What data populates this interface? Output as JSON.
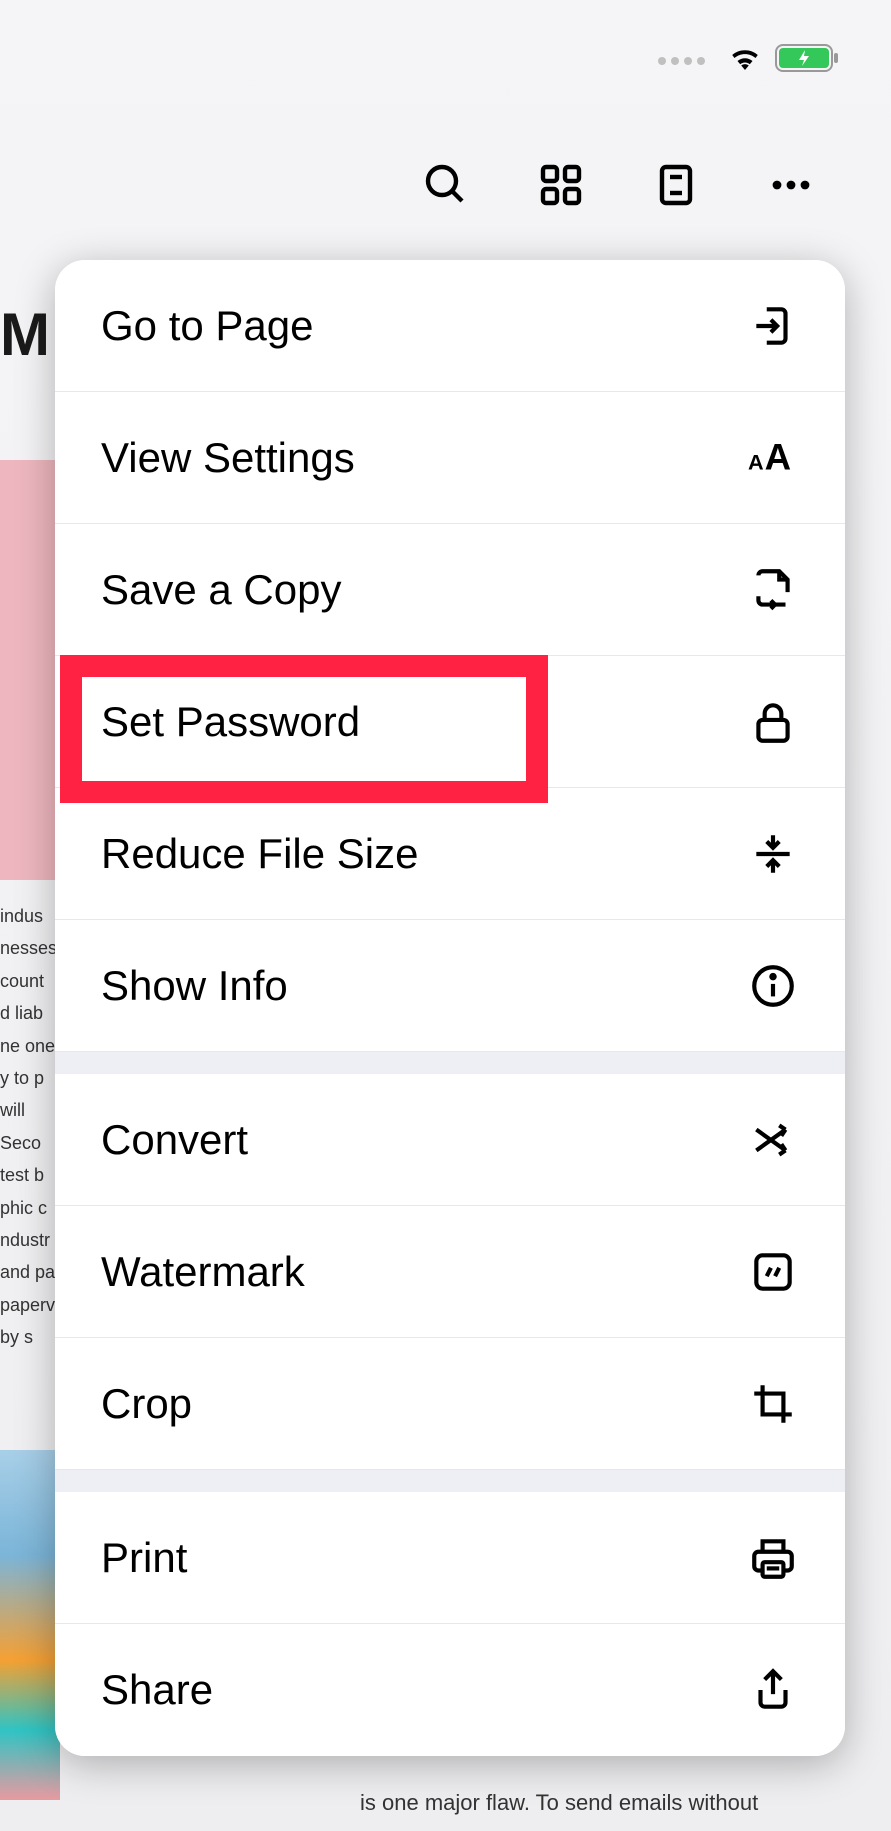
{
  "toolbar": {
    "search_icon": "search-icon",
    "grid_icon": "grid-icon",
    "document_icon": "document-icon",
    "more_icon": "more-icon"
  },
  "menu": {
    "go_to_page": "Go to Page",
    "view_settings": "View Settings",
    "save_copy": "Save a Copy",
    "set_password": "Set Password",
    "reduce_file_size": "Reduce File Size",
    "show_info": "Show Info",
    "convert": "Convert",
    "watermark": "Watermark",
    "crop": "Crop",
    "print": "Print",
    "share": "Share"
  },
  "background": {
    "header_text": "M",
    "body_text": " indus\nnesses\ncount\nd liab\nne one\ny to p\n will \n Seco\ntest b\nphic c\nndustr\nand pa\npaperv\n by s",
    "bottom_text": "is one major flaw. To send emails without"
  },
  "highlight": {
    "target": "set_password"
  }
}
